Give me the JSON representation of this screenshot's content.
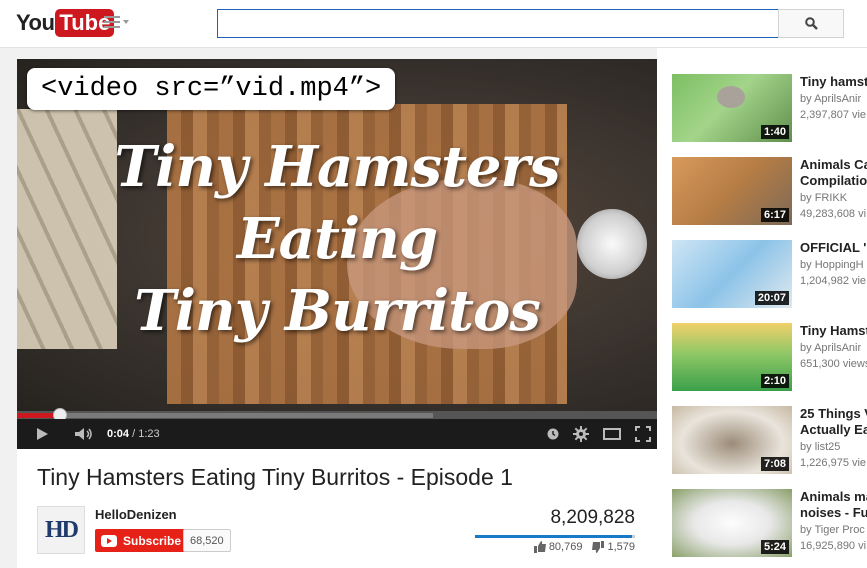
{
  "header": {
    "logo_you": "You",
    "logo_tube": "Tube",
    "search": {
      "value": "",
      "placeholder": ""
    }
  },
  "player": {
    "code_label": "<video src=”vid.mp4”>",
    "overlay_lines": [
      "Tiny Hamsters",
      "Eating",
      "Tiny Burritos"
    ],
    "current_time": "0:04",
    "separator": " / ",
    "duration": "1:23",
    "played_fraction": 0.067,
    "loaded_fraction": 0.65
  },
  "video": {
    "title": "Tiny Hamsters Eating Tiny Burritos - Episode 1",
    "channel": "HelloDenizen",
    "avatar_text": "HD",
    "subscribe_label": "Subscribe",
    "subscriber_count": "68,520",
    "views": "8,209,828",
    "likes": "80,769",
    "dislikes": "1,579",
    "like_fraction": 0.98
  },
  "sidebar": {
    "items": [
      {
        "title": "Tiny hamst",
        "line2": "",
        "by": "by ",
        "author": "AprilsAnir",
        "views": "2,397,807 vie",
        "duration": "1:40"
      },
      {
        "title": "Animals Ca",
        "line2": "Compilatio",
        "by": "by ",
        "author": "FRIKK",
        "views": "49,283,608 vi",
        "duration": "6:17"
      },
      {
        "title": "OFFICIAL '",
        "line2": "",
        "by": "by ",
        "author": "HoppingH",
        "views": "1,204,982 vie",
        "duration": "20:07"
      },
      {
        "title": "Tiny Hamst",
        "line2": "",
        "by": "by ",
        "author": "AprilsAnir",
        "views": "651,300 views",
        "duration": "2:10"
      },
      {
        "title": "25 Things V",
        "line2": "Actually Ea",
        "by": "by ",
        "author": "list25",
        "views": "1,226,975 vie",
        "duration": "7:08"
      },
      {
        "title": "Animals ma",
        "line2": "noises - Fu",
        "by": "by ",
        "author": "Tiger Proc",
        "views": "16,925,890 vi",
        "duration": "5:24"
      }
    ]
  },
  "colors": {
    "brand_red": "#cc181e",
    "subscribe_red": "#e62117",
    "search_border": "#1c62b9",
    "like_blue": "#167ac6"
  }
}
